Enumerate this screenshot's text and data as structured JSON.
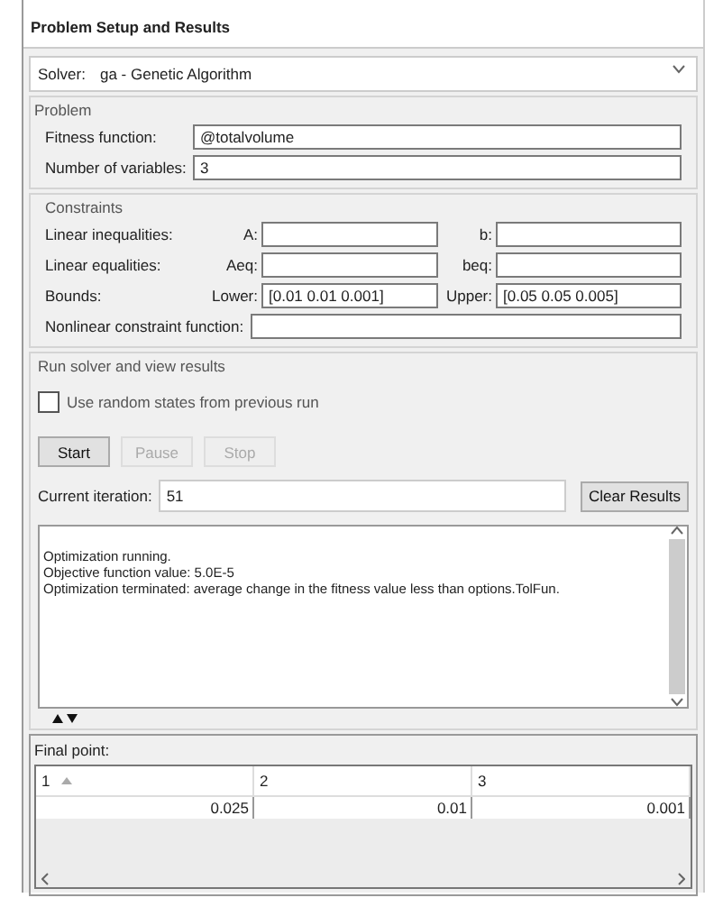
{
  "panel": {
    "title": "Problem Setup and Results"
  },
  "solver": {
    "label": "Solver:",
    "value": "ga - Genetic Algorithm"
  },
  "problem": {
    "title": "Problem",
    "fields": [
      {
        "label": "Fitness function:",
        "value": "@totalvolume"
      },
      {
        "label": "Number of variables:",
        "value": "3"
      }
    ]
  },
  "constraints": {
    "title": "Constraints",
    "rows": [
      {
        "label": "Linear inequalities:",
        "pairs": [
          {
            "label": "A:"
          },
          {
            "label": "b:"
          }
        ]
      },
      {
        "label": "Linear equalities:",
        "pairs": [
          {
            "label": "Aeq:"
          },
          {
            "label": "beq:"
          }
        ]
      },
      {
        "label": "Bounds:",
        "pairs": [
          {
            "label": "Lower:",
            "value": "[0.01 0.01 0.001]"
          },
          {
            "label": "Upper:",
            "value": "[0.05 0.05 0.005]"
          }
        ]
      }
    ],
    "nonlinear": {
      "label": "Nonlinear constraint function:"
    }
  },
  "run": {
    "title": "Run solver and view results",
    "checkbox": {
      "label": "Use random states from previous run",
      "checked": false
    },
    "buttons": [
      {
        "label": "Start",
        "disabled": false
      },
      {
        "label": "Pause",
        "disabled": true
      },
      {
        "label": "Stop",
        "disabled": true
      }
    ],
    "iteration": {
      "label": "Current iteration:",
      "value": "51"
    },
    "clear_button": "Clear Results",
    "output": [
      "Optimization running.",
      "Objective function value: 5.0E-5",
      "Optimization terminated: average change in the fitness value less than options.TolFun."
    ]
  },
  "final_point": {
    "title": "Final point:",
    "columns": [
      {
        "label": "1",
        "sorted": true
      },
      {
        "label": "2",
        "sorted": false
      },
      {
        "label": "3",
        "sorted": false
      }
    ],
    "values": [
      "0.025",
      "0.01",
      "0.001"
    ]
  }
}
